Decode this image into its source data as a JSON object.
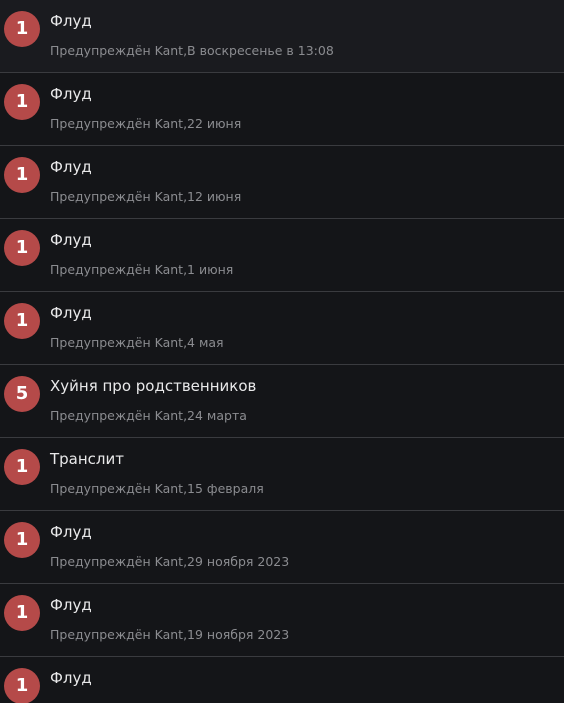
{
  "warnings": [
    {
      "points": "1",
      "title": "Флуд",
      "meta": "Предупреждён Kant,В воскресенье в 13:08"
    },
    {
      "points": "1",
      "title": "Флуд",
      "meta": "Предупреждён Kant,22 июня"
    },
    {
      "points": "1",
      "title": "Флуд",
      "meta": "Предупреждён Kant,12 июня"
    },
    {
      "points": "1",
      "title": "Флуд",
      "meta": "Предупреждён Kant,1 июня"
    },
    {
      "points": "1",
      "title": "Флуд",
      "meta": "Предупреждён Kant,4 мая"
    },
    {
      "points": "5",
      "title": "Хуйня про родственников",
      "meta": "Предупреждён Kant,24 марта"
    },
    {
      "points": "1",
      "title": "Транслит",
      "meta": "Предупреждён Kant,15 февраля"
    },
    {
      "points": "1",
      "title": "Флуд",
      "meta": "Предупреждён Kant,29 ноября 2023"
    },
    {
      "points": "1",
      "title": "Флуд",
      "meta": "Предупреждён Kant,19 ноября 2023"
    },
    {
      "points": "1",
      "title": "Флуд",
      "meta": ""
    }
  ],
  "colors": {
    "background": "#141518",
    "badge": "#b54a49",
    "title": "#e9e9ea",
    "meta": "#8b8c90",
    "divider": "#3a3b3f"
  }
}
